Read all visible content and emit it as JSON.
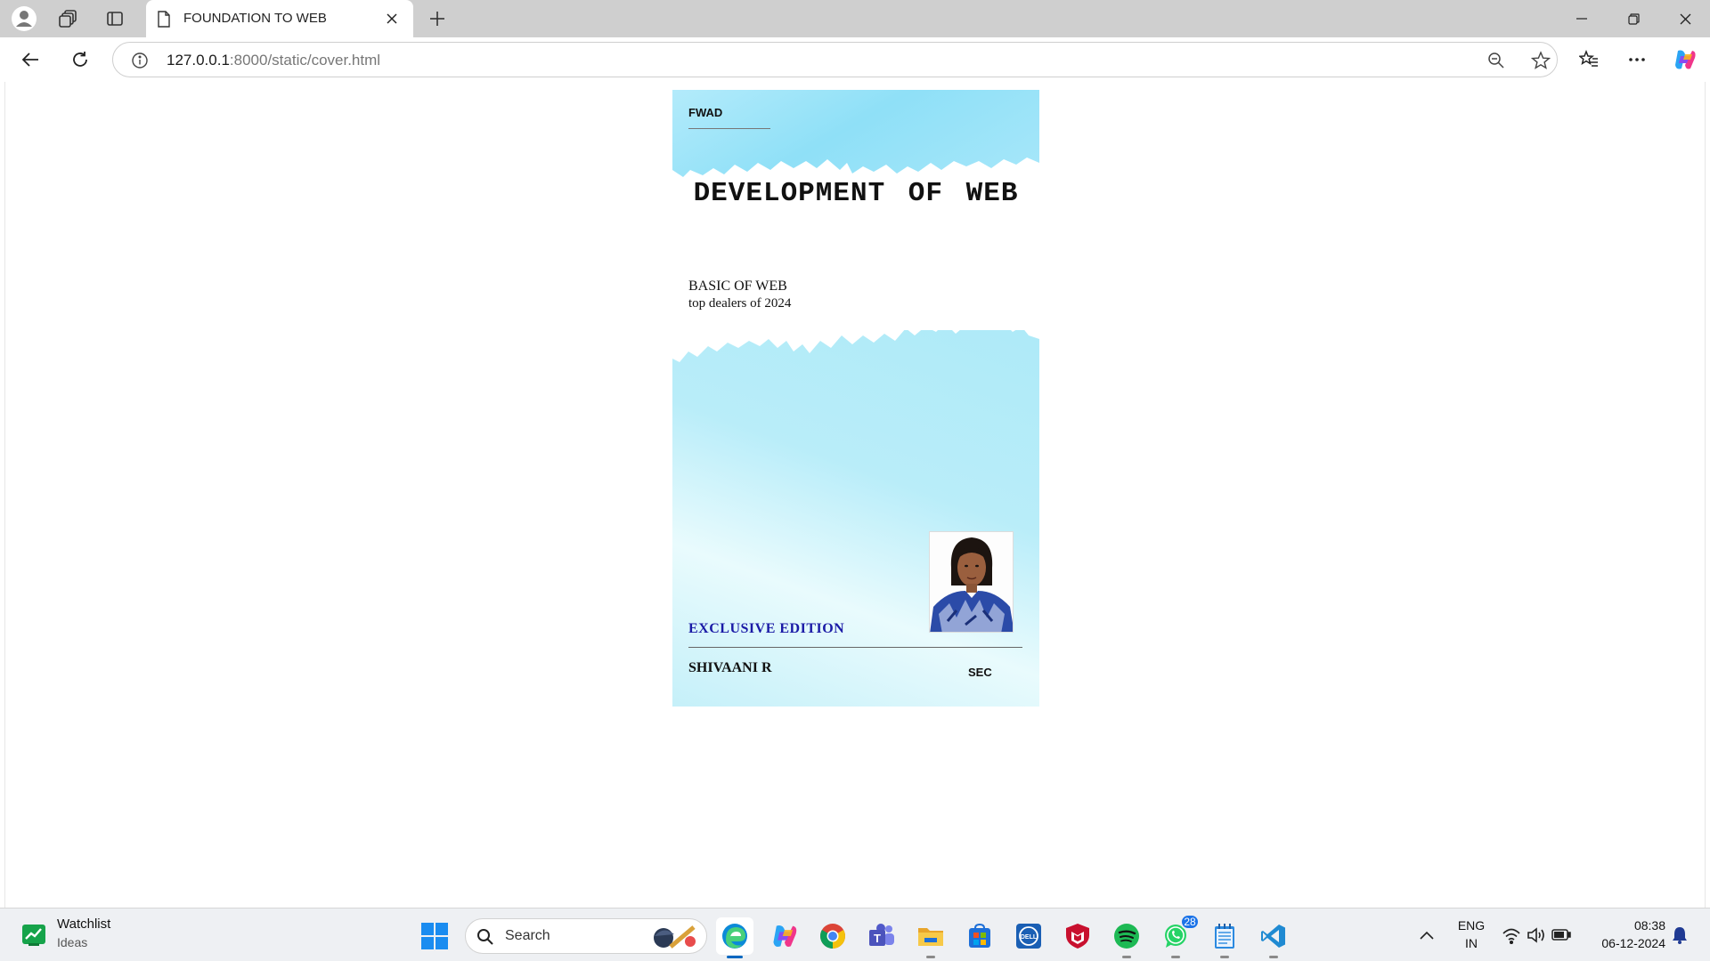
{
  "browser": {
    "tab": {
      "title": "FOUNDATION TO WEB"
    },
    "address": {
      "host": "127.0.0.1",
      "path": ":8000/static/cover.html"
    }
  },
  "cover": {
    "brand": "FWAD",
    "title": "DEVELOPMENT OF WEB",
    "subtitle": "BASIC OF WEB",
    "tagline": "top dealers of 2024",
    "edition": "EXCLUSIVE EDITION",
    "author": "SHIVAANI R",
    "section": "SEC"
  },
  "taskbar": {
    "widget": {
      "title": "Watchlist",
      "subtitle": "Ideas"
    },
    "search_label": "Search",
    "whatsapp_badge": "28",
    "language": {
      "line1": "ENG",
      "line2": "IN"
    },
    "clock": {
      "time": "08:38",
      "date": "06-12-2024"
    }
  },
  "colors": {
    "cover_sky": "#8fe0f7",
    "edition_text": "#1a1aa6",
    "accent": "#0067c0"
  }
}
